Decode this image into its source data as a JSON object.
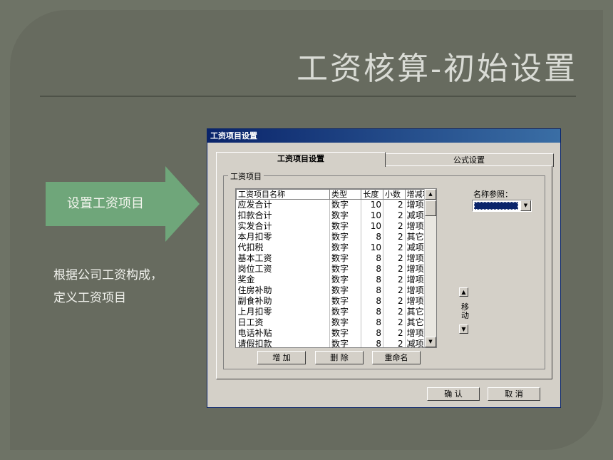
{
  "slide": {
    "title": "工资核算-初始设置",
    "arrow_label": "设置工资项目",
    "description_lines": [
      "根据公司工资构成，",
      "定义工资项目"
    ]
  },
  "window": {
    "title": "工资项目设置",
    "tabs": [
      "工资项目设置",
      "公式设置"
    ],
    "group_label": "工资项目",
    "columns": [
      "工资项目名称",
      "类型",
      "长度",
      "小数",
      "增减项"
    ],
    "rows": [
      [
        "应发合计",
        "数字",
        "10",
        "2",
        "增项"
      ],
      [
        "扣款合计",
        "数字",
        "10",
        "2",
        "减项"
      ],
      [
        "实发合计",
        "数字",
        "10",
        "2",
        "增项"
      ],
      [
        "本月扣零",
        "数字",
        "8",
        "2",
        "其它"
      ],
      [
        "代扣税",
        "数字",
        "10",
        "2",
        "减项"
      ],
      [
        "基本工资",
        "数字",
        "8",
        "2",
        "增项"
      ],
      [
        "岗位工资",
        "数字",
        "8",
        "2",
        "增项"
      ],
      [
        "奖金",
        "数字",
        "8",
        "2",
        "增项"
      ],
      [
        "住房补助",
        "数字",
        "8",
        "2",
        "增项"
      ],
      [
        "副食补助",
        "数字",
        "8",
        "2",
        "增项"
      ],
      [
        "上月扣零",
        "数字",
        "8",
        "2",
        "其它"
      ],
      [
        "日工资",
        "数字",
        "8",
        "2",
        "其它"
      ],
      [
        "电话补贴",
        "数字",
        "8",
        "2",
        "增项"
      ],
      [
        "请假扣款",
        "数字",
        "8",
        "2",
        "减项"
      ]
    ],
    "move_label": "移动",
    "ref_label": "名称参照：",
    "buttons": {
      "add": "增 加",
      "delete": "删 除",
      "rename": "重命名",
      "ok": "确 认",
      "cancel": "取 消"
    }
  },
  "colors": {
    "background": "#676b5f",
    "arrow": "#6fa67a",
    "titlebar": "#0a246a"
  }
}
